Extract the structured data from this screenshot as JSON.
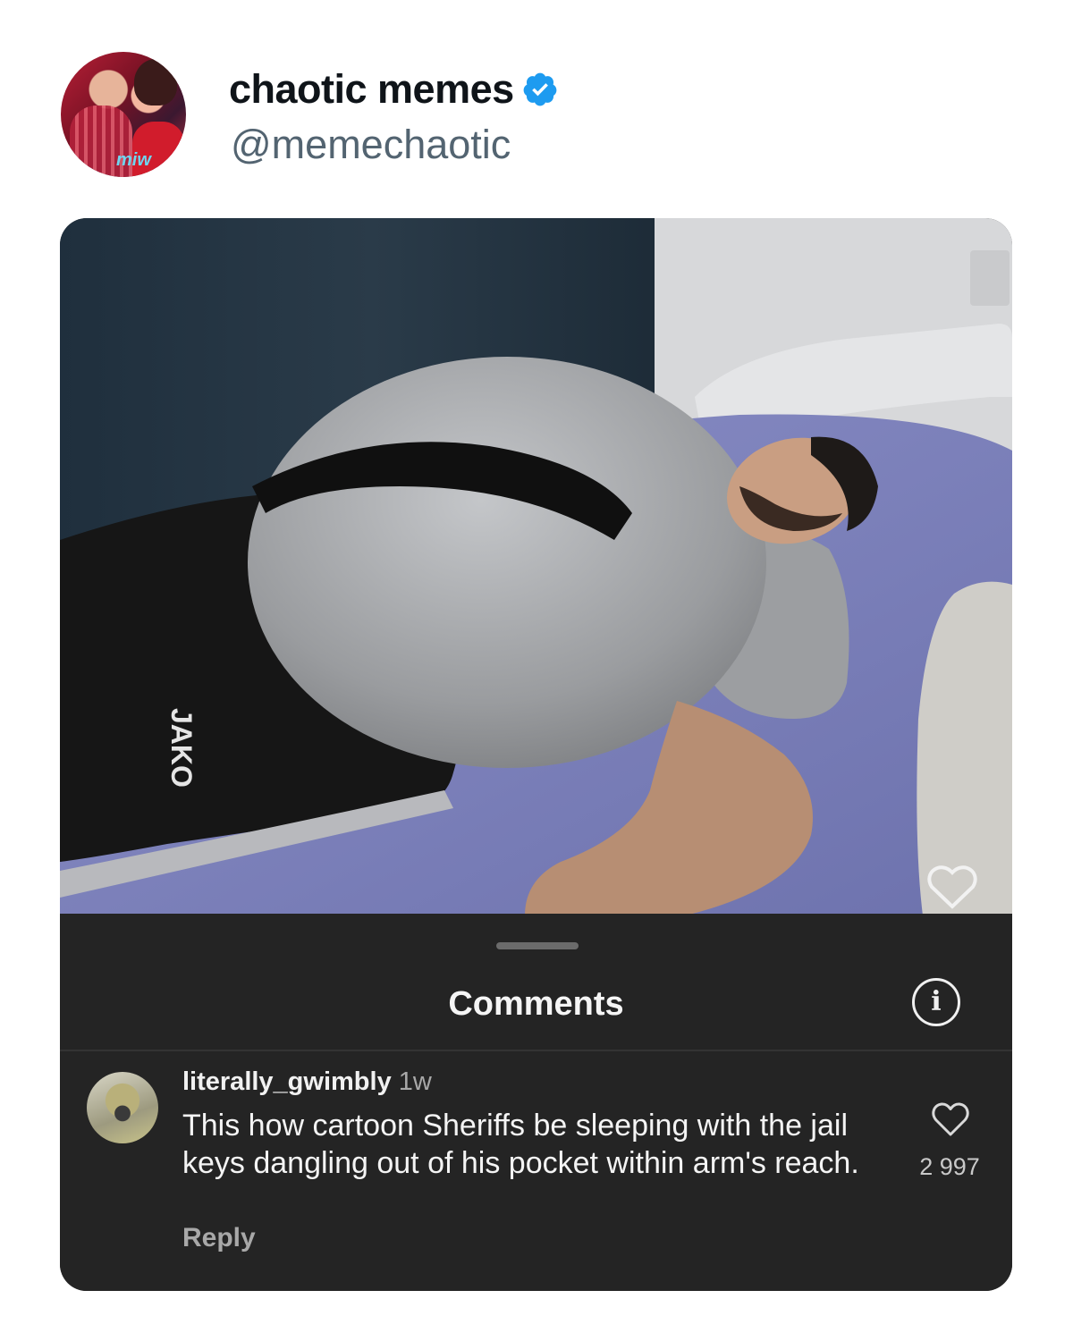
{
  "profile": {
    "display_name": "chaotic memes",
    "handle": "@memechaotic",
    "verified": true,
    "avatar_logo_text": "miw"
  },
  "photo": {
    "description_icon": "post-photo",
    "shorts_brand_text": "JAKO"
  },
  "comments_sheet": {
    "title": "Comments",
    "info_icon": "info-icon",
    "comment": {
      "username": "literally_gwimbly",
      "time": "1w",
      "text": "This how cartoon Sheriffs be sleeping with the jail keys dangling out of his pocket within arm's reach.",
      "reply_label": "Reply",
      "like_count": "2 997"
    }
  },
  "colors": {
    "verified_blue": "#1d9bf0",
    "sheet_background": "#242424",
    "handle_gray": "#536471"
  }
}
